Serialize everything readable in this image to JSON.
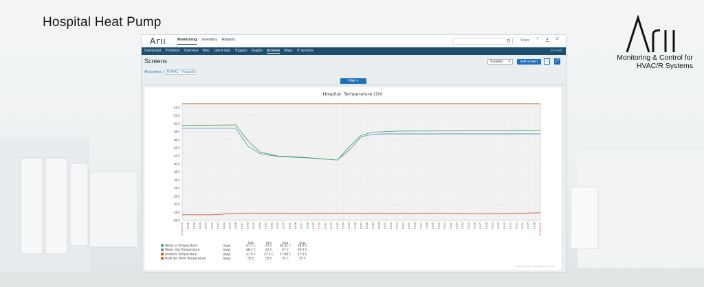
{
  "slide": {
    "title": "Hospital Heat Pump",
    "brand_tagline_line1": "Monitoring & Control for",
    "brand_tagline_line2": "HVAC/R Systems"
  },
  "app": {
    "logo_text": "Arıı",
    "main_menu": [
      "Monitoring",
      "Inventory",
      "Reports"
    ],
    "main_menu_active": "Monitoring",
    "share_label": "Share",
    "help_label": "?",
    "power_label": "⏻",
    "search_placeholder": "",
    "sub_menu": [
      "Dashboard",
      "Problems",
      "Overview",
      "Web",
      "Latest data",
      "Triggers",
      "Graphs",
      "Screens",
      "Maps",
      "IT services"
    ],
    "sub_menu_active": "Screens",
    "node_name": "arii web",
    "page_title": "Screens",
    "screens_select_value": "Screens",
    "edit_screen_label": "Edit screen",
    "fav_icon": "star-icon",
    "fullscreen_icon": "expand-icon",
    "breadcrumb_root": "All screens",
    "breadcrumb_sep": "/",
    "breadcrumb_current": "RHVAC - Hospital",
    "filter_label": "Filter ▾"
  },
  "chart_data": {
    "type": "line",
    "title": "Hospital: Temperature (1h)",
    "ylim": [
      26,
      55
    ],
    "y_ticks": [
      "26 C",
      "28 C",
      "30 C",
      "32 C",
      "34 C",
      "36 C",
      "38 C",
      "40 C",
      "42 C",
      "44 C",
      "46 C",
      "48 C",
      "50 C",
      "52 C",
      "54 C"
    ],
    "x_ticks": [
      "18:38",
      "18:39",
      "18:40",
      "18:41",
      "18:42",
      "18:43",
      "18:44",
      "18:45",
      "18:46",
      "18:47",
      "18:48",
      "18:49",
      "18:50",
      "18:51",
      "18:52",
      "18:53",
      "18:54",
      "18:55",
      "18:56",
      "18:57",
      "18:58",
      "18:59",
      "19:00",
      "19:01",
      "19:02",
      "19:03",
      "19:04",
      "19:05",
      "19:06",
      "19:07",
      "19:08",
      "19:09",
      "19:10",
      "19:11",
      "19:12",
      "19:13",
      "19:14",
      "19:15",
      "19:16",
      "19:17",
      "19:18",
      "19:19",
      "19:20",
      "19:21",
      "19:22",
      "19:23",
      "19:24",
      "19:25",
      "19:26",
      "19:27",
      "19:28",
      "19:29",
      "19:30",
      "19:31",
      "19:32",
      "19:33",
      "19:34",
      "19:35",
      "19:36"
    ],
    "x_start_label": "05-24 18:38",
    "x_end_label": "05-24 19:38",
    "x_mid_label": "19:00",
    "x_range_minutes": [
      0,
      60
    ],
    "grid": true,
    "legend_headers": [
      "last",
      "min",
      "avg",
      "max"
    ],
    "series": [
      {
        "name": "Water In Temperature",
        "agg": "[avg]",
        "color": "#5b8fb9",
        "x": [
          0,
          9,
          11,
          13,
          16,
          21,
          26,
          28,
          30,
          32,
          34,
          60
        ],
        "y": [
          48.9,
          48.9,
          44.5,
          42.6,
          41.9,
          41.5,
          41.0,
          43.5,
          46.8,
          47.4,
          47.5,
          47.5
        ],
        "stats": [
          "47.5 C",
          "41 C",
          "46.41 C",
          "48.9 C"
        ]
      },
      {
        "name": "Water Out Temperature",
        "agg": "[avg]",
        "color": "#4caa65",
        "x": [
          0,
          9,
          11,
          13,
          16,
          21,
          26,
          28,
          30,
          32,
          36,
          60
        ],
        "y": [
          49.6,
          49.7,
          45.8,
          43.0,
          42.0,
          41.6,
          41.0,
          44.3,
          47.2,
          47.9,
          48.2,
          48.3
        ],
        "stats": [
          "48.3 C",
          "41 C",
          "47 C",
          "49.7 C"
        ]
      },
      {
        "name": "Ambient Temperature",
        "agg": "[avg]",
        "color": "#d2543a",
        "x": [
          0,
          5,
          10,
          15,
          20,
          25,
          30,
          35,
          40,
          45,
          50,
          55,
          60
        ],
        "y": [
          27.4,
          27.4,
          27.8,
          27.8,
          27.7,
          27.8,
          27.8,
          27.7,
          27.8,
          27.8,
          27.6,
          27.7,
          27.9
        ],
        "stats": [
          "27.9 C",
          "27.3 C",
          "27.68 C",
          "27.9 C"
        ]
      },
      {
        "name": "Heat Set Point Temperature",
        "agg": "[avg]",
        "color": "#b86a2e",
        "x": [
          0,
          60
        ],
        "y": [
          55,
          55
        ],
        "stats": [
          "55 C",
          "55 C",
          "55 C",
          "55 C"
        ]
      }
    ],
    "footer_note": "Selected history: Generated in 0.14 sec"
  }
}
